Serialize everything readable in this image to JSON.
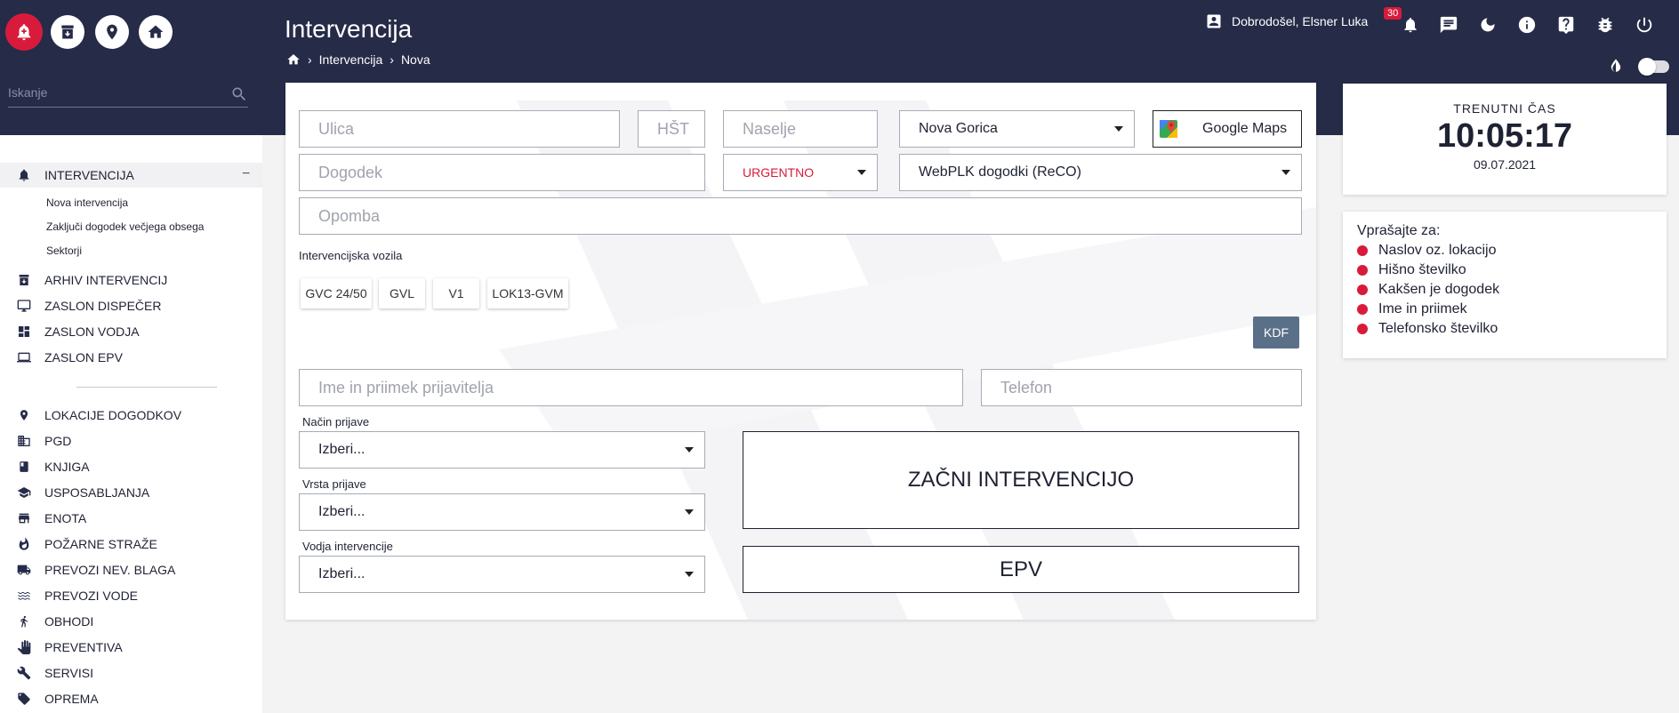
{
  "app": {
    "page_title": "Intervencija",
    "breadcrumb": [
      "Intervencija",
      "Nova"
    ],
    "user_greeting": "Dobrodošel, Elsner Luka",
    "notification_count": "30"
  },
  "search": {
    "placeholder": "Iskanje"
  },
  "sidebar": {
    "active_group": {
      "label": "INTERVENCIJA",
      "sub_items": [
        "Nova intervencija",
        "Zaključi dogodek večjega obsega",
        "Sektorji"
      ]
    },
    "group1": [
      "ARHIV INTERVENCIJ",
      "ZASLON DISPEČER",
      "ZASLON VODJA",
      "ZASLON EPV"
    ],
    "group2": [
      "LOKACIJE DOGODKOV",
      "PGD",
      "KNJIGA",
      "USPOSABLJANJA",
      "ENOTA",
      "POŽARNE STRAŽE",
      "PREVOZI NEV. BLAGA",
      "PREVOZI VODE",
      "OBHODI",
      "PREVENTIVA",
      "SERVISI",
      "OPREMA"
    ]
  },
  "form": {
    "ulica_placeholder": "Ulica",
    "hst_placeholder": "HŠT",
    "naselje_placeholder": "Naselje",
    "obcina_value": "Nova Gorica",
    "maps_label": "Google Maps",
    "dogodek_placeholder": "Dogodek",
    "urgency_value": "URGENTNO",
    "event_source_value": "WebPLK dogodki (ReCO)",
    "opomba_placeholder": "Opomba",
    "vehicles_label": "Intervencijska vozila",
    "vehicles": [
      "GVC 24/50",
      "GVL",
      "V1",
      "LOK13-GVM"
    ],
    "kdf_label": "KDF",
    "reporter_placeholder": "Ime in priimek prijavitelja",
    "phone_placeholder": "Telefon",
    "nacin_label": "Način prijave",
    "nacin_value": "Izberi...",
    "vrsta_label": "Vrsta prijave",
    "vrsta_value": "Izberi...",
    "vodja_label": "Vodja intervencije",
    "vodja_value": "Izberi...",
    "start_button": "ZAČNI INTERVENCIJO",
    "epv_button": "EPV"
  },
  "clock": {
    "label": "TRENUTNI ČAS",
    "time": "10:05:17",
    "date": "09.07.2021"
  },
  "ask": {
    "title": "Vprašajte za:",
    "items": [
      "Naslov oz. lokacijo",
      "Hišno številko",
      "Kakšen je dogodek",
      "Ime in priimek",
      "Telefonsko številko"
    ]
  },
  "colors": {
    "header": "#262b48",
    "accent": "#d81b3a",
    "kdf": "#5a7088"
  }
}
